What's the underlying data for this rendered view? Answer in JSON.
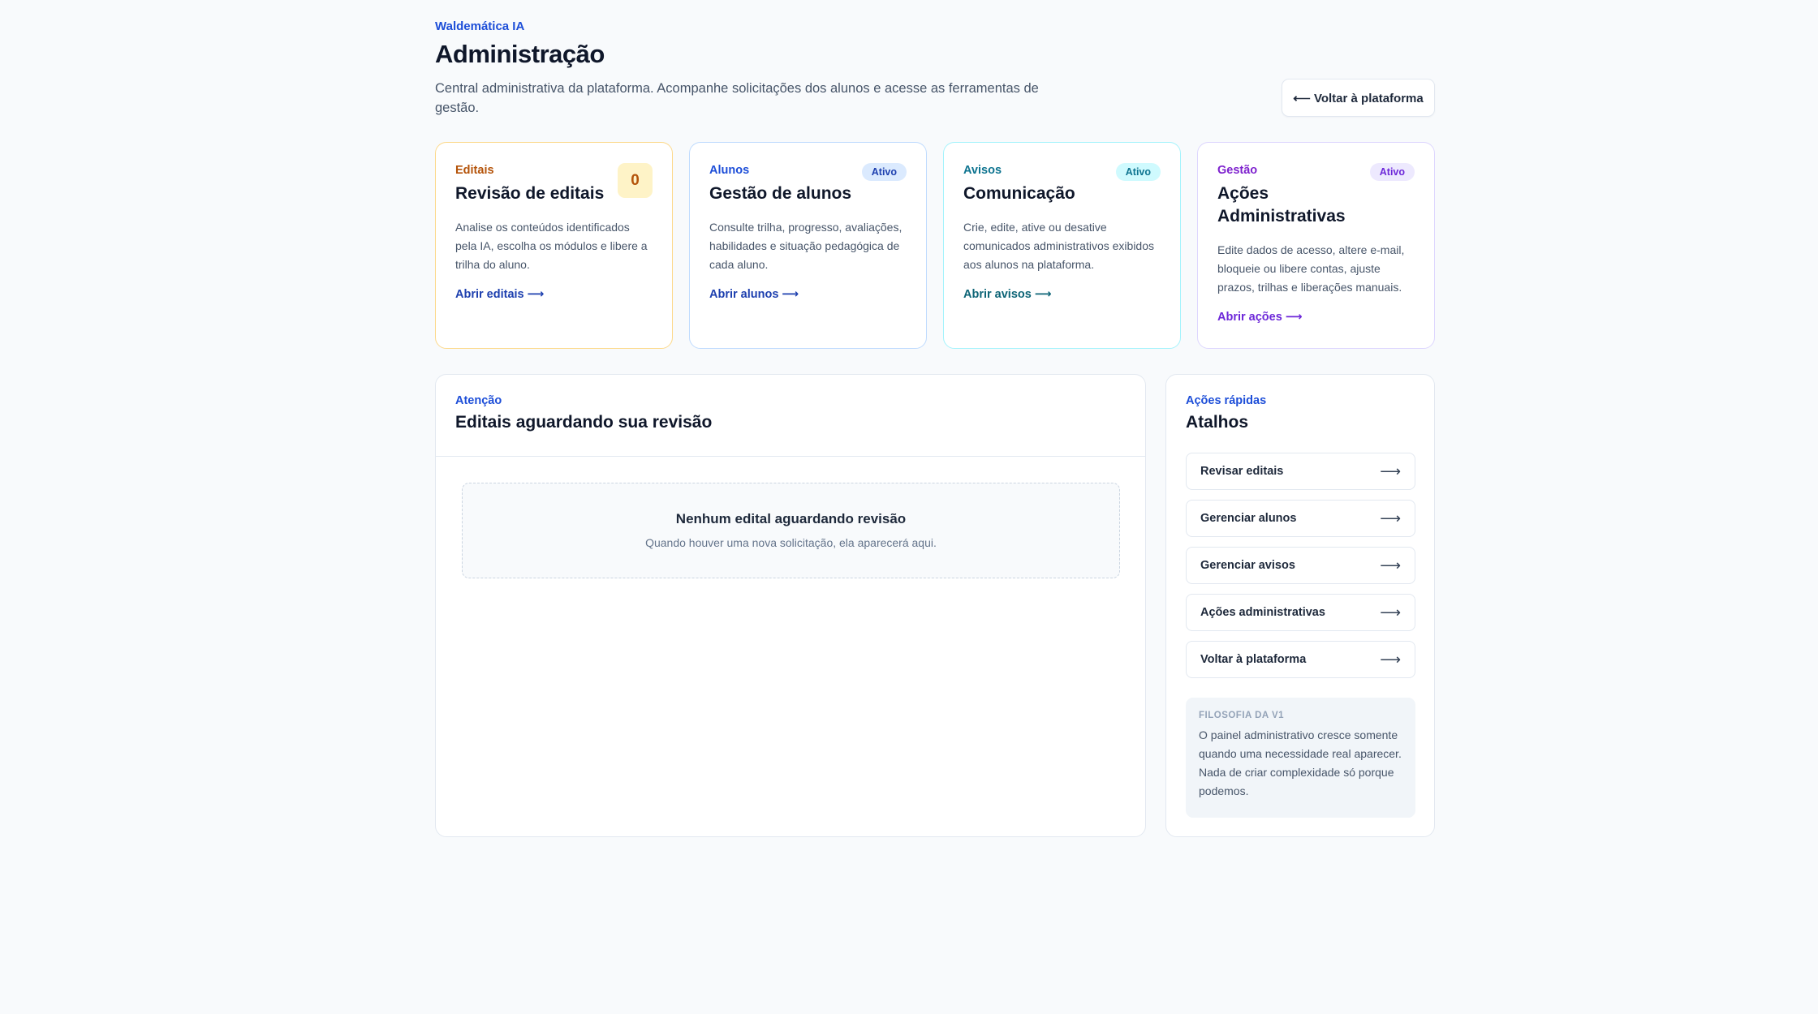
{
  "header": {
    "brand": "Waldemática IA",
    "title": "Administração",
    "subtitle": "Central administrativa da plataforma. Acompanhe solicitações dos alunos e acesse as ferramentas de gestão.",
    "back_label": "⟵ Voltar à plataforma"
  },
  "cards": [
    {
      "category": "Editais",
      "title": "Revisão de editais",
      "badge": "0",
      "description": "Analise os conteúdos identificados pela IA, escolha os módulos e libere a trilha do aluno.",
      "link": "Abrir editais ⟶"
    },
    {
      "category": "Alunos",
      "title": "Gestão de alunos",
      "badge": "Ativo",
      "description": "Consulte trilha, progresso, avaliações, habilidades e situação pedagógica de cada aluno.",
      "link": "Abrir alunos ⟶"
    },
    {
      "category": "Avisos",
      "title": "Comunicação",
      "badge": "Ativo",
      "description": "Crie, edite, ative ou desative comunicados administrativos exibidos aos alunos na plataforma.",
      "link": "Abrir avisos ⟶"
    },
    {
      "category": "Gestão",
      "title": "Ações Administrativas",
      "badge": "Ativo",
      "description": "Edite dados de acesso, altere e-mail, bloqueie ou libere contas, ajuste prazos, trilhas e liberações manuais.",
      "link": "Abrir ações ⟶"
    }
  ],
  "review": {
    "category": "Atenção",
    "title": "Editais aguardando sua revisão",
    "empty_title": "Nenhum edital aguardando revisão",
    "empty_desc": "Quando houver uma nova solicitação, ela aparecerá aqui."
  },
  "shortcuts": {
    "category": "Ações rápidas",
    "title": "Atalhos",
    "arrow": "⟶",
    "items": [
      "Revisar editais",
      "Gerenciar alunos",
      "Gerenciar avisos",
      "Ações administrativas",
      "Voltar à plataforma"
    ]
  },
  "philosophy": {
    "heading": "FILOSOFIA DA V1",
    "text": "O painel administrativo cresce somente quando uma necessidade real aparecer. Nada de criar complexidade só porque podemos."
  }
}
